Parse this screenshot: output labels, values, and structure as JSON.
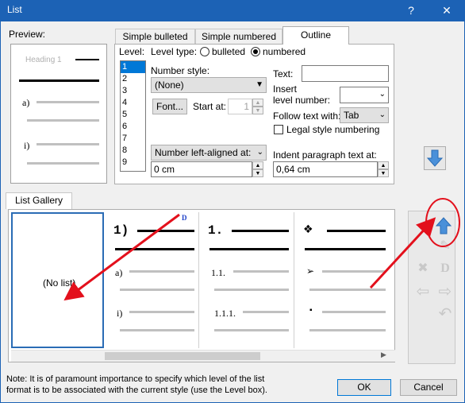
{
  "window": {
    "title": "List",
    "help": "?",
    "close": "✕"
  },
  "preview": {
    "label": "Preview:",
    "heading": "Heading 1",
    "item_a": "a)",
    "item_i": "i)"
  },
  "tabs": {
    "simple_bulleted": "Simple bulleted",
    "simple_numbered": "Simple numbered",
    "outline": "Outline"
  },
  "outline": {
    "level_label": "Level:",
    "levels": [
      "1",
      "2",
      "3",
      "4",
      "5",
      "6",
      "7",
      "8",
      "9"
    ],
    "level_type_label": "Level type:",
    "bulleted_label": "bulleted",
    "numbered_label": "numbered",
    "text_label": "Text:",
    "text_value": "",
    "number_style_label": "Number style:",
    "number_style_value": "(None)",
    "insert_level_label_1": "Insert",
    "insert_level_label_2": "level number:",
    "insert_level_value": "",
    "font_button": "Font...",
    "start_at_label": "Start at:",
    "start_at_value": "1",
    "follow_text_label": "Follow text with:",
    "follow_text_value": "Tab",
    "legal_style_label": "Legal style numbering",
    "alignment_value": "Number left-aligned at:",
    "alignment_spin_value": "0 cm",
    "indent_label": "Indent paragraph text at:",
    "indent_value": "0,64 cm"
  },
  "gallery": {
    "tab_label": "List Gallery",
    "no_list": "(No list)",
    "col2": {
      "top": "1)",
      "a": "a)",
      "i": "i)",
      "badge": "D"
    },
    "col3": {
      "top": "1.",
      "l2": "1.1.",
      "l3": "1.1.1."
    },
    "col4": {
      "top": "❖",
      "l2": "➢",
      "l3": "▪"
    }
  },
  "footer": {
    "note_line1": "Note: It is of paramount importance to specify which level of the list",
    "note_line2": "format is to be associated with the current style (use the Level box).",
    "ok": "OK",
    "cancel": "Cancel"
  },
  "colors": {
    "titlebar": "#1c62b5",
    "accent": "#0078d7",
    "annotation": "#e3101c"
  }
}
